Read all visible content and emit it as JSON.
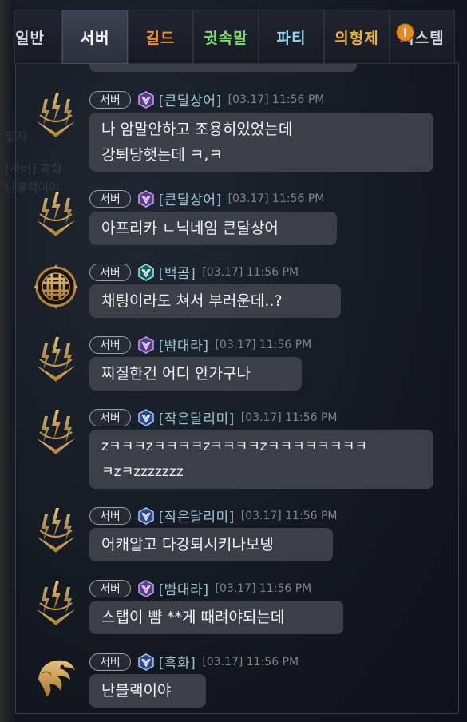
{
  "tabs": [
    {
      "label": "일반",
      "color": "#d5d8de",
      "active": false
    },
    {
      "label": "서버",
      "color": "#ffffff",
      "active": true
    },
    {
      "label": "길드",
      "color": "#f0902a",
      "active": false
    },
    {
      "label": "귓속말",
      "color": "#7dde6a",
      "active": false
    },
    {
      "label": "파티",
      "color": "#8fd6ee",
      "active": false
    },
    {
      "label": "의형제",
      "color": "#e6b23b",
      "active": false
    },
    {
      "label": "시스템",
      "color": "#d5d8de",
      "active": false,
      "badge": "!"
    }
  ],
  "background_ghost_text": [
    "일지",
    "[서버] 흑화",
    "난블랙이야"
  ],
  "messages": [
    {
      "channel": "서버",
      "rank_icon": "purple-rank-icon",
      "name": "[큰달상어]",
      "time": "[03.17] 11:56 PM",
      "text": "나 암말안하고 조용히있었는데\n강퇴당햇는데 ㅋ,ㅋ",
      "avatar": "gold-lightning-emblem"
    },
    {
      "channel": "서버",
      "rank_icon": "purple-rank-icon",
      "name": "[큰달상어]",
      "time": "[03.17] 11:56 PM",
      "text": "아프리카 ㄴ닉네임 큰달상어",
      "avatar": "gold-lightning-emblem"
    },
    {
      "channel": "서버",
      "rank_icon": "teal-rank-icon",
      "name": "[백곰]",
      "time": "[03.17] 11:56 PM",
      "text": "채팅이라도 쳐서 부러운데..?",
      "avatar": "gold-knot-emblem"
    },
    {
      "channel": "서버",
      "rank_icon": "purple-rank-icon",
      "name": "[뺨대라]",
      "time": "[03.17] 11:56 PM",
      "text": "찌질한건 어디 안가구나",
      "avatar": "gold-lightning-emblem"
    },
    {
      "channel": "서버",
      "rank_icon": "blue-rank-icon",
      "name": "[작은달리미]",
      "time": "[03.17] 11:56 PM",
      "text": "zㅋㅋㅋzㅋㅋㅋㅋzㅋㅋㅋㅋzㅋㅋㅋㅋㅋㅋㅋㅋ\nㅋzㅋzzzzzzz",
      "avatar": "gold-lightning-emblem"
    },
    {
      "channel": "서버",
      "rank_icon": "blue-rank-icon",
      "name": "[작은달리미]",
      "time": "[03.17] 11:56 PM",
      "text": "어캐알고 다강퇴시키나보넹",
      "avatar": "gold-lightning-emblem"
    },
    {
      "channel": "서버",
      "rank_icon": "purple-rank-icon",
      "name": "[뺨대라]",
      "time": "[03.17] 11:56 PM",
      "text": "스탭이 뺨 **게 때려야되는데",
      "avatar": "gold-lightning-emblem"
    },
    {
      "channel": "서버",
      "rank_icon": "blue-rank-icon",
      "name": "[흑화]",
      "time": "[03.17] 11:56 PM",
      "text": "난블랙이야",
      "avatar": "gold-dragon-emblem"
    }
  ]
}
